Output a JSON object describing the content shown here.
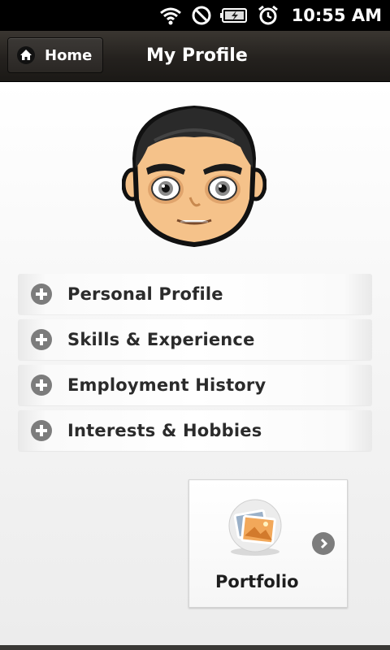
{
  "status_bar": {
    "time": "10:55 AM",
    "icons": [
      "wifi-icon",
      "no-signal-icon",
      "battery-charging-icon",
      "alarm-clock-icon"
    ]
  },
  "title_bar": {
    "home_label": "Home",
    "home_icon": "home-icon",
    "title": "My Profile"
  },
  "profile": {
    "avatar": "avatar-face-icon"
  },
  "menu": {
    "items": [
      {
        "label": "Personal Profile",
        "icon": "plus-circle-icon"
      },
      {
        "label": "Skills & Experience",
        "icon": "plus-circle-icon"
      },
      {
        "label": "Employment History",
        "icon": "plus-circle-icon"
      },
      {
        "label": "Interests & Hobbies",
        "icon": "plus-circle-icon"
      }
    ]
  },
  "portfolio": {
    "label": "Portfolio",
    "icon": "photos-icon",
    "arrow_icon": "chevron-right-icon"
  },
  "colors": {
    "title_bar": "#24211e",
    "background": "#f2f2f2",
    "text": "#2b2b2b",
    "icon_gray": "#7c7c7c"
  }
}
